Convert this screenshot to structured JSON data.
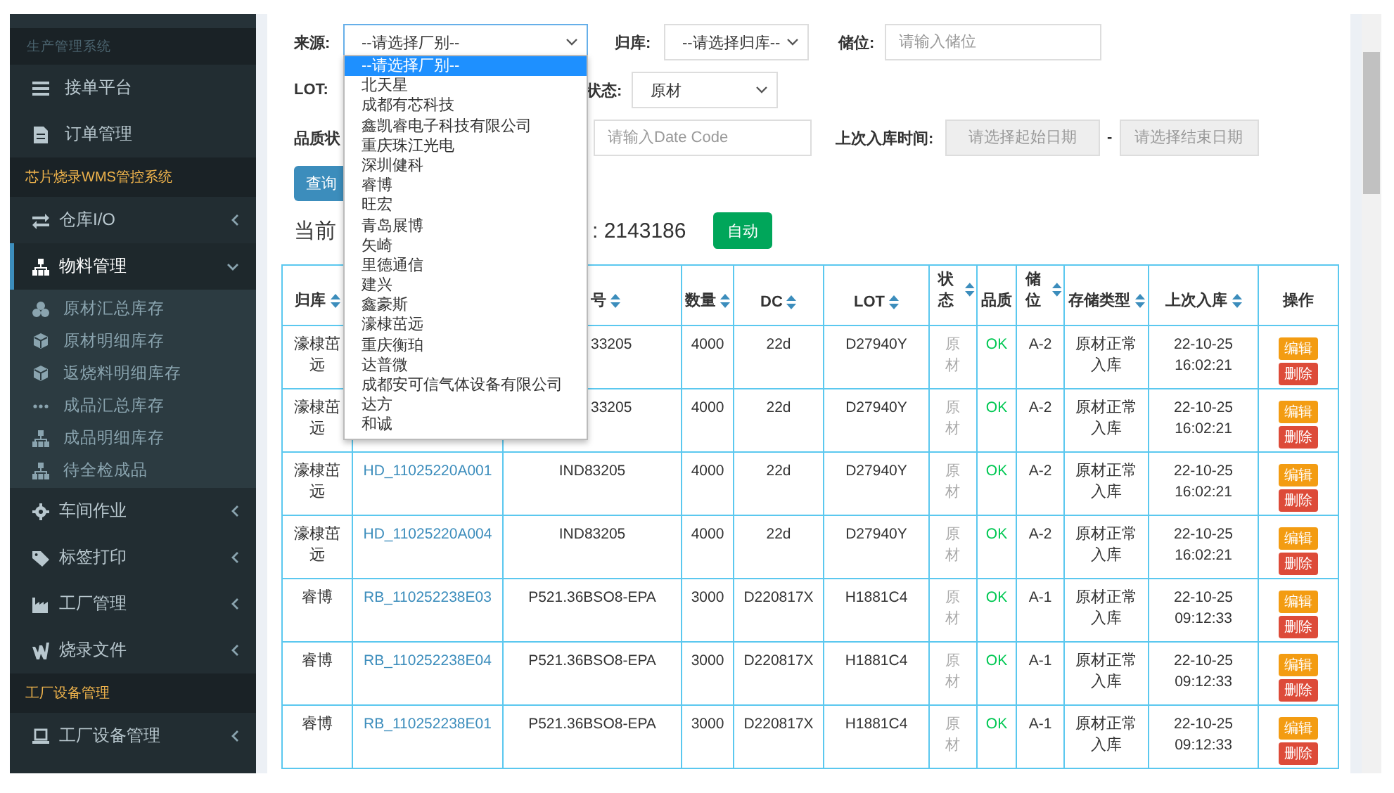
{
  "sidebar": {
    "items": [
      {
        "kind": "header",
        "label": "生产管理系统"
      },
      {
        "kind": "link",
        "label": "接单平台",
        "selected": false
      },
      {
        "kind": "link",
        "label": "订单管理",
        "selected": false
      },
      {
        "kind": "section",
        "label": "芯片烧录WMS管控系统"
      },
      {
        "kind": "tree",
        "label": "仓库I/O",
        "expanded": false,
        "selected": false
      },
      {
        "kind": "tree",
        "label": "物料管理",
        "expanded": true,
        "selected": true,
        "children": [
          {
            "label": "原材汇总库存"
          },
          {
            "label": "原材明细库存"
          },
          {
            "label": "返烧料明细库存"
          },
          {
            "label": "成品汇总库存"
          },
          {
            "label": "成品明细库存"
          },
          {
            "label": "待全检成品"
          }
        ]
      },
      {
        "kind": "tree",
        "label": "车间作业",
        "expanded": false,
        "selected": false
      },
      {
        "kind": "tree",
        "label": "标签打印",
        "expanded": false,
        "selected": false
      },
      {
        "kind": "tree",
        "label": "工厂管理",
        "expanded": false,
        "selected": false
      },
      {
        "kind": "tree",
        "label": "烧录文件",
        "expanded": false,
        "selected": false
      },
      {
        "kind": "section",
        "label": "工厂设备管理"
      },
      {
        "kind": "tree",
        "label": "工厂设备管理",
        "expanded": false,
        "selected": false
      }
    ]
  },
  "filters": {
    "source": {
      "label": "来源:",
      "value": "--请选择厂别--"
    },
    "return_warehouse": {
      "label": "归库:",
      "value": "--请选择归库--"
    },
    "location": {
      "label": "储位:",
      "placeholder": "请输入储位"
    },
    "lot": {
      "label": "LOT:"
    },
    "status": {
      "label": "状态:",
      "value": "原材"
    },
    "quality": {
      "label": "品质状"
    },
    "date_code": {
      "placeholder": "请输入Date Code"
    },
    "last_in_time": {
      "label": "上次入库时间:",
      "start_placeholder": "请选择起始日期",
      "separator": "-",
      "end_placeholder": "请选择结束日期"
    }
  },
  "query_button": "查询",
  "summary": {
    "label": "当前",
    "count": ": 2143186"
  },
  "auto_button": "自动",
  "source_dropdown": {
    "options": [
      {
        "label": "--请选择厂别--",
        "selected": true
      },
      {
        "label": "北天星",
        "selected": false
      },
      {
        "label": "成都有芯科技",
        "selected": false
      },
      {
        "label": "鑫凯睿电子科技有限公司",
        "selected": false
      },
      {
        "label": "重庆珠江光电",
        "selected": false
      },
      {
        "label": "深圳健科",
        "selected": false
      },
      {
        "label": "睿博",
        "selected": false
      },
      {
        "label": "旺宏",
        "selected": false
      },
      {
        "label": "青岛展博",
        "selected": false
      },
      {
        "label": "矢崎",
        "selected": false
      },
      {
        "label": "里德通信",
        "selected": false
      },
      {
        "label": "建兴",
        "selected": false
      },
      {
        "label": "鑫豪斯",
        "selected": false
      },
      {
        "label": "濠棣茁远",
        "selected": false
      },
      {
        "label": "重庆衡珀",
        "selected": false
      },
      {
        "label": "达普微",
        "selected": false
      },
      {
        "label": "成都安可信气体设备有限公司",
        "selected": false
      },
      {
        "label": "达方",
        "selected": false
      },
      {
        "label": "和诚",
        "selected": false
      }
    ]
  },
  "table": {
    "columns": [
      {
        "label": "归库",
        "sortable": true
      },
      {
        "label": "号",
        "sortable": true,
        "covered": true
      },
      {
        "label": "数量",
        "sortable": true
      },
      {
        "label": "DC",
        "sortable": true
      },
      {
        "label": "LOT",
        "sortable": true
      },
      {
        "label": "状态",
        "sortable": true
      },
      {
        "label": "品质",
        "sortable": false
      },
      {
        "label": "储位",
        "sortable": true
      },
      {
        "label": "存储类型",
        "sortable": true
      },
      {
        "label": "上次入库",
        "sortable": true
      },
      {
        "label": "操作",
        "sortable": false
      }
    ],
    "rows": [
      {
        "covered": true,
        "warehouse": "濠棣茁远",
        "model": "33205",
        "qty": "4000",
        "dc": "22d",
        "lot": "D27940Y",
        "status": "原材",
        "quality": "OK",
        "location": "A-2",
        "storage_type": "原材正常入库",
        "last_in": "22-10-25 16:02:21",
        "actions": [
          "编辑",
          "删除"
        ]
      },
      {
        "covered": true,
        "warehouse": "濠棣茁远",
        "model": "33205",
        "qty": "4000",
        "dc": "22d",
        "lot": "D27940Y",
        "status": "原材",
        "quality": "OK",
        "location": "A-2",
        "storage_type": "原材正常入库",
        "last_in": "22-10-25 16:02:21",
        "actions": [
          "编辑",
          "删除"
        ]
      },
      {
        "covered": false,
        "warehouse": "濠棣茁远",
        "barcode": "HD_11025220A001",
        "model": "IND83205",
        "qty": "4000",
        "dc": "22d",
        "lot": "D27940Y",
        "status": "原材",
        "quality": "OK",
        "location": "A-2",
        "storage_type": "原材正常入库",
        "last_in": "22-10-25 16:02:21",
        "actions": [
          "编辑",
          "删除"
        ]
      },
      {
        "covered": false,
        "warehouse": "濠棣茁远",
        "barcode": "HD_11025220A004",
        "model": "IND83205",
        "qty": "4000",
        "dc": "22d",
        "lot": "D27940Y",
        "status": "原材",
        "quality": "OK",
        "location": "A-2",
        "storage_type": "原材正常入库",
        "last_in": "22-10-25 16:02:21",
        "actions": [
          "编辑",
          "删除"
        ]
      },
      {
        "covered": false,
        "warehouse": "睿博",
        "barcode": "RB_110252238E03",
        "model": "P521.36BSO8-EPA",
        "qty": "3000",
        "dc": "D220817X",
        "lot": "H1881C4",
        "status": "原材",
        "quality": "OK",
        "location": "A-1",
        "storage_type": "原材正常入库",
        "last_in": "22-10-25 09:12:33",
        "actions": [
          "编辑",
          "删除"
        ]
      },
      {
        "covered": false,
        "warehouse": "睿博",
        "barcode": "RB_110252238E04",
        "model": "P521.36BSO8-EPA",
        "qty": "3000",
        "dc": "D220817X",
        "lot": "H1881C4",
        "status": "原材",
        "quality": "OK",
        "location": "A-1",
        "storage_type": "原材正常入库",
        "last_in": "22-10-25 09:12:33",
        "actions": [
          "编辑",
          "删除"
        ]
      },
      {
        "covered": false,
        "warehouse": "睿博",
        "barcode": "RB_110252238E01",
        "model": "P521.36BSO8-EPA",
        "qty": "3000",
        "dc": "D220817X",
        "lot": "H1881C4",
        "status": "原材",
        "quality": "OK",
        "location": "A-1",
        "storage_type": "原材正常入库",
        "last_in": "22-10-25 09:12:33",
        "actions": [
          "编辑",
          "删除"
        ]
      }
    ]
  }
}
